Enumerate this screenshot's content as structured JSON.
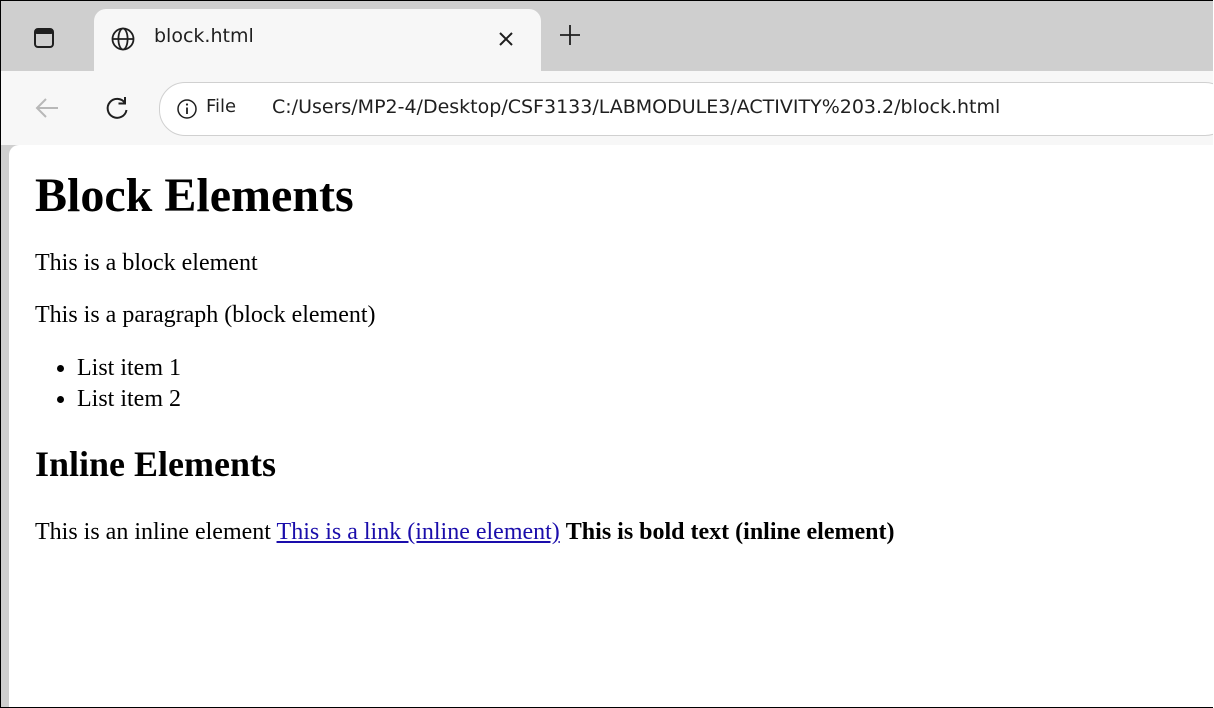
{
  "browser": {
    "tab": {
      "title": "block.html",
      "favicon": "globe-icon"
    },
    "window_menu_icon": "window-icon",
    "close_tab_icon": "close-icon",
    "new_tab_icon": "plus-icon",
    "back_icon": "back-arrow-icon",
    "reload_icon": "reload-icon",
    "address_bar": {
      "info_icon": "info-icon",
      "scheme_label": "File",
      "url": "C:/Users/MP2-4/Desktop/CSF3133/LABMODULE3/ACTIVITY%203.2/block.html"
    },
    "colors": {
      "tabstrip": "#cfcfcf",
      "toolbar": "#f7f7f7",
      "link": "#1a0dab"
    }
  },
  "page": {
    "heading": "Block Elements",
    "block_div_text": "This is a block element",
    "paragraph_text": "This is a paragraph (block element)",
    "list_items": [
      "List item 1",
      "List item 2"
    ],
    "subheading": "Inline Elements",
    "inline_span_text": "This is an inline element",
    "link_text": "This is a link (inline element)",
    "bold_text": "This is bold text (inline element)"
  }
}
